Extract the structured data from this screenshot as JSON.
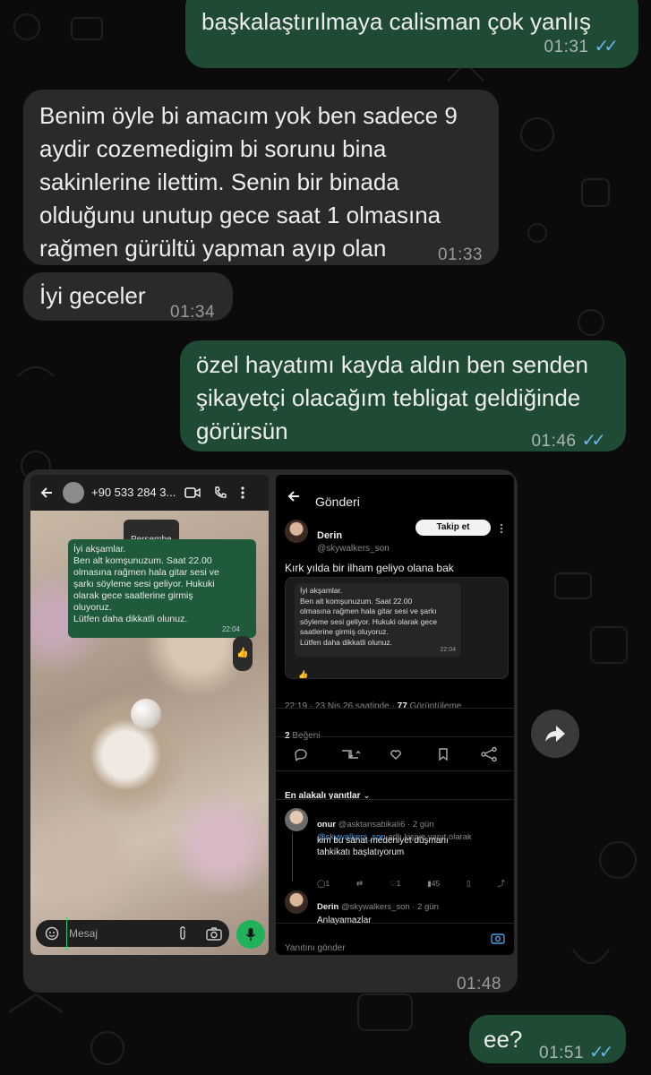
{
  "messages": [
    {
      "text": "başkalaştırılmaya calisman çok yanlış",
      "time": "01:31"
    },
    {
      "lines": [
        "Benim öyle bi amacım yok ben sadece 9",
        "aydir cozemedigim bi sorunu bina",
        "sakinlerine ilettim. Senin bir binada",
        "olduğunu unutup gece saat 1 olmasına",
        "rağmen gürültü yapman ayıp olan"
      ],
      "time": "01:33"
    },
    {
      "text": "İyi geceler",
      "time": "01:34"
    },
    {
      "lines": [
        "özel hayatımı kayda aldın ben senden",
        "şikayetçi olacağım tebligat geldiğinde",
        "görürsün"
      ],
      "time": "01:46"
    },
    {
      "time": "01:48"
    },
    {
      "text": "ee?",
      "time": "01:51"
    }
  ],
  "ticks": "✓✓",
  "wa_shot": {
    "contact": "+90 533 284 3...",
    "day": "Perşembe",
    "msg_lines": [
      "İyi akşamlar.",
      "Ben alt komşunuzum. Saat 22.00",
      "olmasına rağmen hala gitar sesi ve",
      "şarkı söyleme sesi geliyor. Hukuki",
      "olarak gece saatlerine girmiş",
      "oluyoruz.",
      "Lütfen daha dikkatli olunuz."
    ],
    "msg_time": "22:04",
    "reaction": "👍",
    "input_placeholder": "Mesaj"
  },
  "x_shot": {
    "header": "Gönderi",
    "author": "Derin",
    "handle": "@skywalkers_son",
    "follow": "Takip et",
    "post_text": "Kırk yılda bir ilham geliyo olana bak",
    "quote_lines": [
      "İyi akşamlar.",
      "Ben alt komşunuzum. Saat 22.00",
      "olmasına rağmen hala gitar sesi ve şarkı",
      "söyleme sesi geliyor. Hukuki olarak gece",
      "saatlerine girmiş oluyoruz.",
      "Lütfen daha dikkatli olunuz."
    ],
    "quote_time": "22:04",
    "quote_reaction": "👍",
    "meta": "22:19 · 23 Nis 26 saatinde · ",
    "views": "77",
    "views_label": " Görüntüleme",
    "likes": "2",
    "likes_label": " Beğeni",
    "replies_filter": "En alakalı yanıtlar",
    "reply1": {
      "name": "onur",
      "handle": "@asktansabikali6 · 2 gün",
      "to_prefix": "@skywalkers_son",
      "to_suffix": " adlı kişiye yanıt olarak",
      "text_lines": [
        "kim bu sanat medeniyet düşmanı",
        "tahkikatı başlatıyorum"
      ],
      "stats": [
        "1",
        "",
        "1",
        "45"
      ]
    },
    "reply2": {
      "name": "Derin",
      "handle": "@skywalkers_son · 2 gün",
      "text": "Anlayamazlar"
    },
    "reply_input": "Yanıtını gönder"
  }
}
